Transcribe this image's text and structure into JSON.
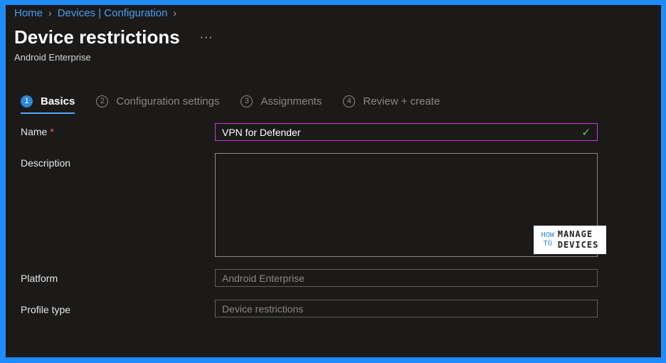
{
  "breadcrumb": {
    "items": [
      "Home",
      "Devices | Configuration"
    ]
  },
  "header": {
    "title": "Device restrictions",
    "more": "···",
    "subtitle": "Android Enterprise"
  },
  "steps": [
    {
      "num": "1",
      "label": "Basics"
    },
    {
      "num": "2",
      "label": "Configuration settings"
    },
    {
      "num": "3",
      "label": "Assignments"
    },
    {
      "num": "4",
      "label": "Review + create"
    }
  ],
  "form": {
    "name_label": "Name",
    "required_mark": "*",
    "name_value": "VPN for Defender",
    "description_label": "Description",
    "description_value": "",
    "platform_label": "Platform",
    "platform_value": "Android Enterprise",
    "profile_type_label": "Profile type",
    "profile_type_value": "Device restrictions"
  },
  "watermark": {
    "how": "HOW",
    "to": "TO",
    "manage": "MANAGE",
    "devices": "DEVICES"
  },
  "colors": {
    "accent": "#2b88d8",
    "link": "#479ef5",
    "focus_border": "#c239d6",
    "valid": "#6ccb5f",
    "outer_frame": "#1f8bff"
  }
}
